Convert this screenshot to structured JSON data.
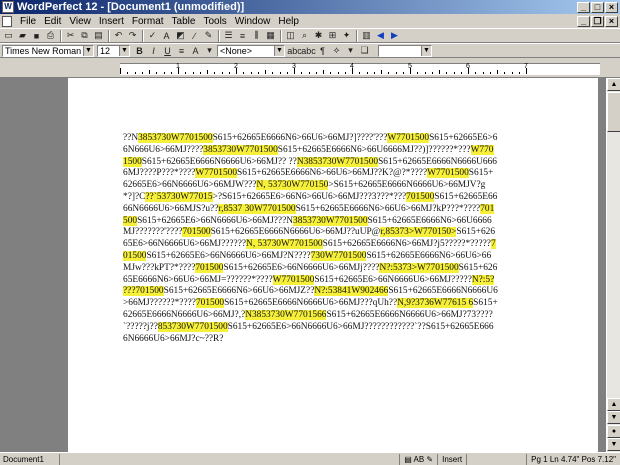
{
  "window": {
    "title": "WordPerfect 12 - [Document1 (unmodified)]",
    "minimize": "_",
    "maximize": "□",
    "close": "×"
  },
  "menu": [
    "File",
    "Edit",
    "View",
    "Insert",
    "Format",
    "Table",
    "Tools",
    "Window",
    "Help"
  ],
  "property_bar": {
    "font_name": "Times New Roman",
    "font_size": "12",
    "style": "<None>"
  },
  "ruler": {
    "labels": [
      "1",
      "2",
      "3",
      "4",
      "5",
      "6",
      "7"
    ]
  },
  "document": {
    "paragraphs": [
      [
        {
          "t": "??N",
          "h": false
        },
        {
          "t": "3853730W7701500",
          "h": true
        },
        {
          "t": "S615+62665E6666N6>66U6>66MJ?]????'???",
          "h": false
        },
        {
          "t": "W7701500",
          "h": true
        },
        {
          "t": "S615+62665E6>66N666U6>66MJ????",
          "h": false
        },
        {
          "t": "3853730W7701500",
          "h": true
        },
        {
          "t": "S615+62665E6666N6>66U6666MJ??)]??????*???",
          "h": false
        },
        {
          "t": "W7701500",
          "h": true
        },
        {
          "t": "S615+62665E6666N6666U6>66MJ?? ??",
          "h": false
        },
        {
          "t": "N3853730W7701500",
          "h": true
        },
        {
          "t": "S615+62665E6666N6666U6666MJ????P???*????",
          "h": false
        },
        {
          "t": "W7701500",
          "h": true
        },
        {
          "t": "S615+62665E6666N6>66U6>66MJ??K?@?*????",
          "h": false
        },
        {
          "t": "W7701500",
          "h": true
        },
        {
          "t": "S615+62665E6>66N6666U6>66MJW???",
          "h": false
        },
        {
          "t": "N, 53730W770150",
          "h": true
        },
        {
          "t": ">S615+62665E6666N6666U6>66MJV?g*?]?C",
          "h": false
        },
        {
          "t": "??`53730W77015",
          "h": true
        },
        {
          "t": ">?S615+62665E6>66N6>66U6>66MJ???3???*???",
          "h": false
        },
        {
          "t": "701500",
          "h": true
        },
        {
          "t": "S615+62665E6666N6666U6>66MJS?u??",
          "h": false
        },
        {
          "t": "r,8537 30W7701500",
          "h": true
        },
        {
          "t": "S615+62665E6666N6>66U6>66MJ?kP???*????",
          "h": false
        },
        {
          "t": "701500",
          "h": true
        },
        {
          "t": "S615+62665E6>66N6666U6>66MJ???N",
          "h": false
        },
        {
          "t": "3853730W7701500",
          "h": true
        },
        {
          "t": "S615+62665E6666N6>66U6666MJ???????'????",
          "h": false
        },
        {
          "t": "701500",
          "h": true
        },
        {
          "t": "S615+62665E6666N6666U6>66MJ??uUP@",
          "h": false
        },
        {
          "t": "r,85373>W770150>",
          "h": true
        },
        {
          "t": "S615+62665E6>66N6666U6>66MJ??????",
          "h": false
        },
        {
          "t": "N, 53730W7701500",
          "h": true
        },
        {
          "t": "S615+62665E6666N6>66MJ?j5?????*?????",
          "h": false
        },
        {
          "t": "701500",
          "h": true
        },
        {
          "t": "S615+62665E6>66N6666U6>66MJ?N????",
          "h": false
        },
        {
          "t": "730W7701500",
          "h": true
        },
        {
          "t": "S615+62665E6666N6>66U6>66MJw???kPT?*????",
          "h": false
        },
        {
          "t": "701500",
          "h": true
        },
        {
          "t": "S615+62665E6>66N6666U6>66MJj????",
          "h": false
        },
        {
          "t": "N?:5373>W7701500",
          "h": true
        },
        {
          "t": "S615+62665E6666N6>66U6>66MJ=??????*????",
          "h": false
        },
        {
          "t": "W7701500",
          "h": true
        },
        {
          "t": "S615+62665E6>66N6666U6>66MJ?????",
          "h": false
        },
        {
          "t": "N?:5? ???701500",
          "h": true
        },
        {
          "t": "S615+62665E6666N6>66U6>66MJZ??",
          "h": false
        },
        {
          "t": "N?:53841W902466",
          "h": true
        },
        {
          "t": "S615+62665E6666N6666U6>66MJ??????*????",
          "h": false
        },
        {
          "t": "701500",
          "h": true
        },
        {
          "t": "S615+62665E6666N6666U6>66MJ???qUh??",
          "h": false
        },
        {
          "t": "N,9?3736W77615 6",
          "h": true
        },
        {
          "t": "S615+62665E6666N6666U6>66MJ?,?",
          "h": false
        },
        {
          "t": "N3853730W7701566",
          "h": true
        },
        {
          "t": "S615+62665E6666N6666U6>66MJ?73????`?????j??",
          "h": false
        },
        {
          "t": "853730W7701500",
          "h": true
        },
        {
          "t": "S615+62665E6>66N6666U6>66MJ????????????`??S615+62665E6666N6666U6>66MJ?c~??R?",
          "h": false
        }
      ]
    ]
  },
  "status": {
    "document_name": "Document1",
    "insert_mode": "Insert",
    "position": "Pg 1 Ln 4.74\" Pos 7.12\""
  }
}
